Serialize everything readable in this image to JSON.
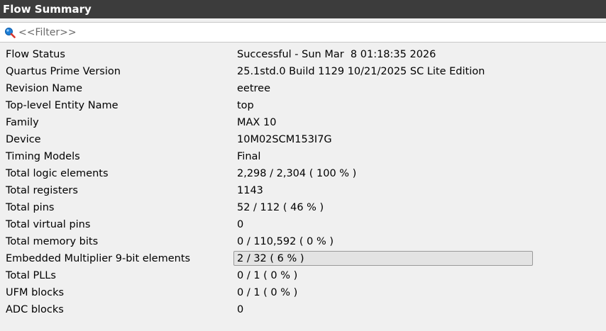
{
  "panel": {
    "title": "Flow Summary"
  },
  "filter": {
    "placeholder": "<<Filter>>",
    "value": ""
  },
  "rows": [
    {
      "key": "Flow Status",
      "value": "Successful - Sun Mar  8 01:18:35 2026"
    },
    {
      "key": "Quartus Prime Version",
      "value": "25.1std.0 Build 1129 10/21/2025 SC Lite Edition"
    },
    {
      "key": "Revision Name",
      "value": "eetree"
    },
    {
      "key": "Top-level Entity Name",
      "value": "top"
    },
    {
      "key": "Family",
      "value": "MAX 10"
    },
    {
      "key": "Device",
      "value": "10M02SCM153I7G"
    },
    {
      "key": "Timing Models",
      "value": "Final"
    },
    {
      "key": "Total logic elements",
      "value": "2,298 / 2,304 ( 100 % )"
    },
    {
      "key": "Total registers",
      "value": "1143"
    },
    {
      "key": "Total pins",
      "value": "52 / 112 ( 46 % )"
    },
    {
      "key": "Total virtual pins",
      "value": "0"
    },
    {
      "key": "Total memory bits",
      "value": "0 / 110,592 ( 0 % )"
    },
    {
      "key": "Embedded Multiplier 9-bit elements",
      "value": "2 / 32 ( 6 % )"
    },
    {
      "key": "Total PLLs",
      "value": "0 / 1 ( 0 % )"
    },
    {
      "key": "UFM blocks",
      "value": "0 / 1 ( 0 % )"
    },
    {
      "key": "ADC blocks",
      "value": "0"
    }
  ],
  "selected_row_index": 12,
  "colors": {
    "titlebar_bg": "#3c3c3c",
    "panel_bg": "#f0f0f0",
    "search_icon": "#1e7fd6"
  }
}
